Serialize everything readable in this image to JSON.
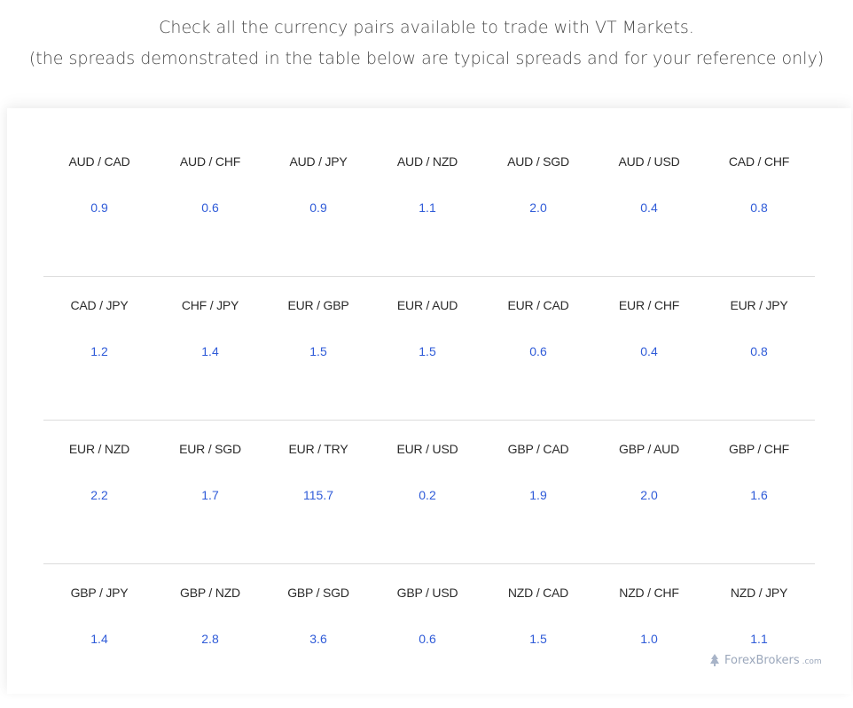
{
  "intro": {
    "line1": "Check all the currency pairs available to trade with VT Markets.",
    "line2": "(the spreads demonstrated in the table below are typical spreads and for your reference only)"
  },
  "rows": [
    [
      {
        "pair": "AUD / CAD",
        "spread": "0.9"
      },
      {
        "pair": "AUD / CHF",
        "spread": "0.6"
      },
      {
        "pair": "AUD / JPY",
        "spread": "0.9"
      },
      {
        "pair": "AUD / NZD",
        "spread": "1.1"
      },
      {
        "pair": "AUD / SGD",
        "spread": "2.0"
      },
      {
        "pair": "AUD / USD",
        "spread": "0.4"
      },
      {
        "pair": "CAD / CHF",
        "spread": "0.8"
      }
    ],
    [
      {
        "pair": "CAD / JPY",
        "spread": "1.2"
      },
      {
        "pair": "CHF / JPY",
        "spread": "1.4"
      },
      {
        "pair": "EUR / GBP",
        "spread": "1.5"
      },
      {
        "pair": "EUR / AUD",
        "spread": "1.5"
      },
      {
        "pair": "EUR / CAD",
        "spread": "0.6"
      },
      {
        "pair": "EUR / CHF",
        "spread": "0.4"
      },
      {
        "pair": "EUR / JPY",
        "spread": "0.8"
      }
    ],
    [
      {
        "pair": "EUR / NZD",
        "spread": "2.2"
      },
      {
        "pair": "EUR / SGD",
        "spread": "1.7"
      },
      {
        "pair": "EUR / TRY",
        "spread": "115.7"
      },
      {
        "pair": "EUR / USD",
        "spread": "0.2"
      },
      {
        "pair": "GBP / CAD",
        "spread": "1.9"
      },
      {
        "pair": "GBP / AUD",
        "spread": "2.0"
      },
      {
        "pair": "GBP / CHF",
        "spread": "1.6"
      }
    ],
    [
      {
        "pair": "GBP / JPY",
        "spread": "1.4"
      },
      {
        "pair": "GBP / NZD",
        "spread": "2.8"
      },
      {
        "pair": "GBP / SGD",
        "spread": "3.6"
      },
      {
        "pair": "GBP / USD",
        "spread": "0.6"
      },
      {
        "pair": "NZD / CAD",
        "spread": "1.5"
      },
      {
        "pair": "NZD / CHF",
        "spread": "1.0"
      },
      {
        "pair": "NZD / JPY",
        "spread": "1.1"
      }
    ]
  ],
  "watermark": {
    "icon": "forexbrokers-logo-icon",
    "text": "ForexBrokers",
    "domain": ".com"
  },
  "colors": {
    "spread": "#2f5bd8",
    "pair": "#2b2b2b",
    "divider": "#dcdcdc"
  }
}
